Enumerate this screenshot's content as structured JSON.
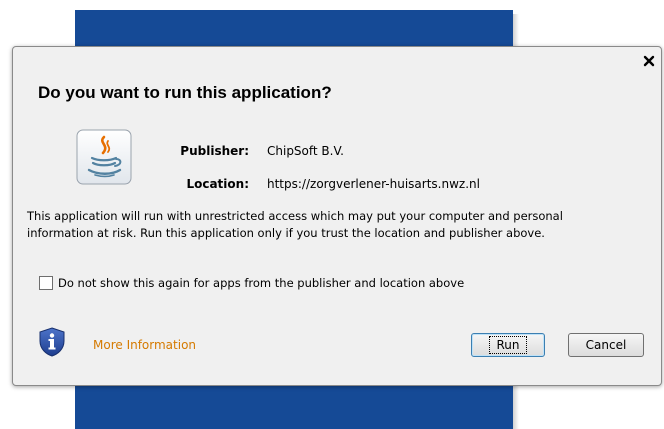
{
  "dialog": {
    "title": "Do you want to run this application?",
    "close_label": "×",
    "publisher_label": "Publisher:",
    "publisher_value": "ChipSoft B.V.",
    "location_label": "Location:",
    "location_value": "https://zorgverlener-huisarts.nwz.nl",
    "message_line1": "This application will run with unrestricted access which may put your computer and personal",
    "message_line2": "information at risk. Run this application only if you trust the location and publisher above.",
    "checkbox_label": "Do not show this again for apps from the publisher and location above",
    "checkbox_checked": false,
    "more_info_label": "More Information",
    "run_label": "Run",
    "cancel_label": "Cancel"
  },
  "icons": {
    "java": "java-icon",
    "shield": "shield-info-icon",
    "close": "close-icon"
  },
  "colors": {
    "background_window": "#154a96",
    "dialog_bg": "#f0f0f0",
    "more_info_link": "#d57a00",
    "shield_blue": "#2a4fa8"
  }
}
